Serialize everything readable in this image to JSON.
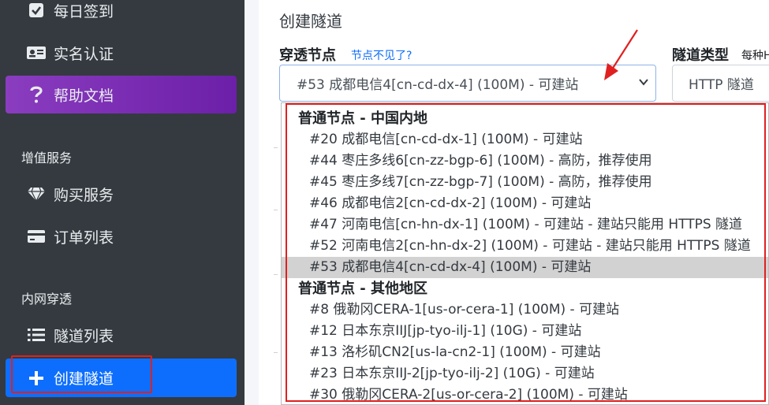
{
  "sidebar": {
    "items": [
      {
        "label": "每日签到",
        "icon": "checkbox-icon"
      },
      {
        "label": "实名认证",
        "icon": "id-card-icon"
      },
      {
        "label": "帮助文档",
        "icon": "question-icon"
      },
      {
        "label": "购买服务",
        "icon": "diamond-icon"
      },
      {
        "label": "订单列表",
        "icon": "credit-card-icon"
      },
      {
        "label": "隧道列表",
        "icon": "list-icon"
      },
      {
        "label": "创建隧道",
        "icon": "plus-icon"
      }
    ],
    "sections": [
      "增值服务",
      "内网穿透"
    ]
  },
  "main": {
    "title": "创建隧道",
    "node_label": "穿透节点",
    "node_help": "节点不见了?",
    "node_selected": "#53 成都电信4[cn-cd-dx-4] (100M) - 可建站",
    "type_label": "隧道类型",
    "type_label_sub": "每种H",
    "type_selected": "HTTP 隧道"
  },
  "dropdown": {
    "groups": [
      {
        "label": "普通节点 - 中国内地",
        "options": [
          "#20 成都电信[cn-cd-dx-1] (100M) - 可建站",
          "#44 枣庄多线6[cn-zz-bgp-6] (100M) - 高防，推荐使用",
          "#45 枣庄多线7[cn-zz-bgp-7] (100M) - 高防，推荐使用",
          "#46 成都电信2[cn-cd-dx-2] (100M) - 可建站",
          "#47 河南电信[cn-hn-dx-1] (100M) - 可建站 - 建站只能用 HTTPS 隧道",
          "#52 河南电信2[cn-hn-dx-2] (100M) - 可建站 - 建站只能用 HTTPS 隧道",
          "#53 成都电信4[cn-cd-dx-4] (100M) - 可建站"
        ]
      },
      {
        "label": "普通节点 - 其他地区",
        "options": [
          "#8 俄勒冈CERA-1[us-or-cera-1] (100M) - 可建站",
          "#12 日本东京IIJ[jp-tyo-ilj-1] (10G) - 可建站",
          "#13 洛杉矶CN2[us-la-cn2-1] (100M) - 可建站",
          "#23 日本东京IIJ-2[jp-tyo-ilj-2] (10G) - 可建站",
          "#30 俄勒冈CERA-2[us-or-cera-2] (100M) - 可建站"
        ]
      }
    ]
  },
  "colors": {
    "sidebar_bg": "#343a40",
    "help_bg": "#7b2fb5",
    "active_bg": "#0d6efd",
    "highlight": "#e02020",
    "selected_option_bg": "#d2d2d2"
  }
}
